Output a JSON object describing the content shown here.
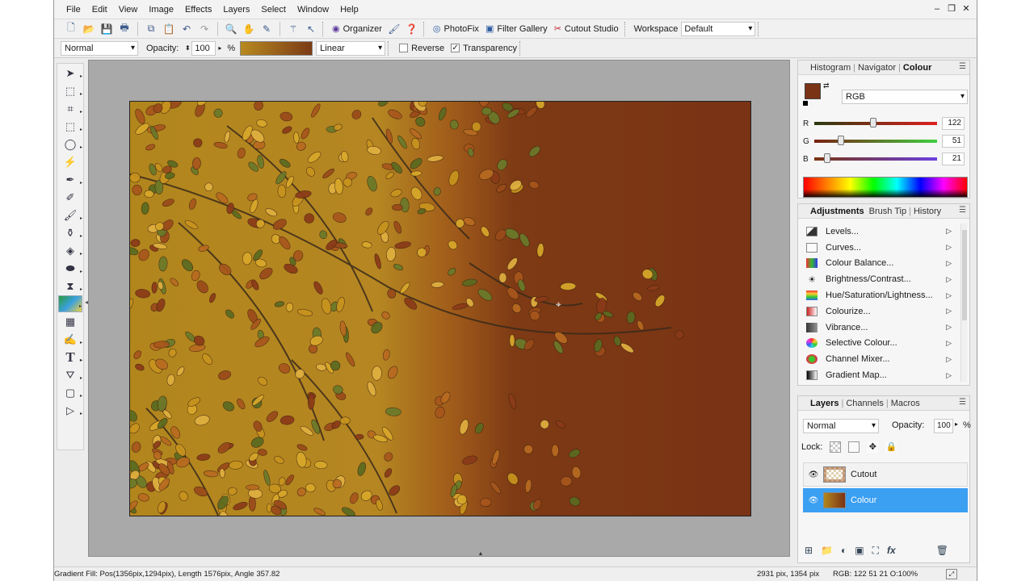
{
  "menu": [
    "File",
    "Edit",
    "View",
    "Image",
    "Effects",
    "Layers",
    "Select",
    "Window",
    "Help"
  ],
  "toolbar": {
    "organizer": "Organizer",
    "photofix": "PhotoFix",
    "filter_gallery": "Filter Gallery",
    "cutout_studio": "Cutout Studio",
    "workspace_label": "Workspace",
    "workspace_value": "Default"
  },
  "options": {
    "blend_mode": "Normal",
    "opacity_label": "Opacity:",
    "opacity_value": "100",
    "opacity_unit": "%",
    "gradient_type": "Linear",
    "reverse_label": "Reverse",
    "reverse_checked": false,
    "transparency_label": "Transparency",
    "transparency_checked": true
  },
  "colour_panel": {
    "tabs": [
      "Histogram",
      "Navigator",
      "Colour"
    ],
    "active_tab": "Colour",
    "model": "RGB",
    "r": "122",
    "g": "51",
    "b": "21",
    "r_label": "R",
    "g_label": "G",
    "b_label": "B",
    "swatch_color": "#7a3315"
  },
  "adjustments_panel": {
    "tabs": [
      "Adjustments",
      "Brush Tip",
      "History"
    ],
    "items": [
      "Levels...",
      "Curves...",
      "Colour Balance...",
      "Brightness/Contrast...",
      "Hue/Saturation/Lightness...",
      "Colourize...",
      "Vibrance...",
      "Selective Colour...",
      "Channel Mixer...",
      "Gradient Map..."
    ]
  },
  "layers_panel": {
    "tabs": [
      "Layers",
      "Channels",
      "Macros"
    ],
    "blend_mode": "Normal",
    "opacity_label": "Opacity:",
    "opacity_value": "100",
    "opacity_unit": "%",
    "lock_label": "Lock:",
    "layers": [
      {
        "name": "Cutout",
        "selected": false
      },
      {
        "name": "Colour",
        "selected": true
      }
    ]
  },
  "status": {
    "left": "Gradient Fill: Pos(1356pix,1294pix), Length 1576pix, Angle 357.82",
    "size": "2931 pix, 1354 pix",
    "rgb": "RGB: 122 51 21 O:100%"
  }
}
